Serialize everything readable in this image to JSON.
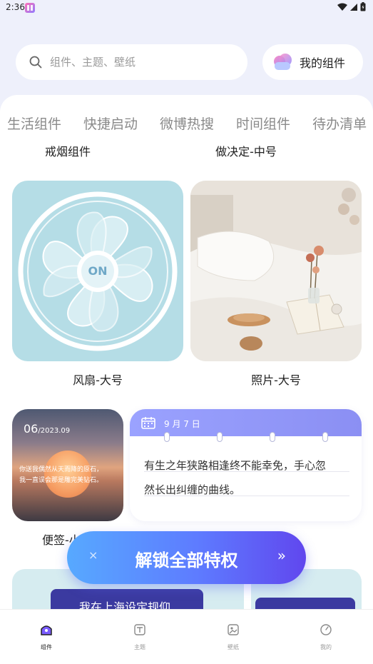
{
  "status_bar": {
    "time": "2:36"
  },
  "search": {
    "placeholder": "组件、主题、壁纸"
  },
  "my_widgets": {
    "label": "我的组件"
  },
  "tabs": [
    "生活组件",
    "快捷启动",
    "微博热搜",
    "时间组件",
    "待办清单"
  ],
  "row_captions": {
    "left": "戒烟组件",
    "right": "做决定-中号"
  },
  "cards": {
    "fan": {
      "caption": "风扇-大号",
      "button_label": "ON"
    },
    "photo": {
      "caption": "照片-大号"
    },
    "sunset": {
      "caption": "便签-小",
      "day": "06",
      "month_year": "/2023.09",
      "text_line1": "你送我偶然从天而降的原石，",
      "text_line2": "我一直误会那是雕完美钻石。"
    },
    "note": {
      "date": "9 月 7 日",
      "text_line1": "有生之年狭路相逢终不能幸免，手心忽",
      "text_line2": "然长出纠缠的曲线。"
    }
  },
  "bottom_card_text": "我在上海设定规仰",
  "unlock": {
    "close": "×",
    "label": "解锁全部特权",
    "arrow": "»"
  },
  "nav": [
    {
      "label": "组件",
      "active": true
    },
    {
      "label": "主题",
      "active": false
    },
    {
      "label": "壁纸",
      "active": false
    },
    {
      "label": "我的",
      "active": false
    }
  ],
  "colors": {
    "accent": "#6047ee",
    "fan_bg": "#b5dde6",
    "note_header": "#9aa2ff"
  }
}
